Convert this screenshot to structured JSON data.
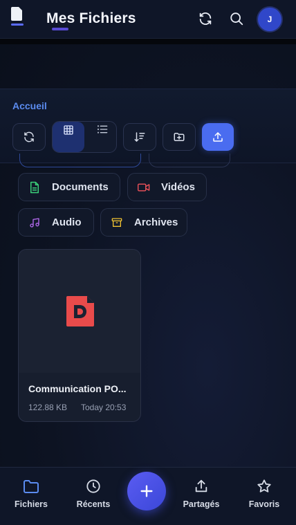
{
  "header": {
    "title": "Mes Fichiers",
    "avatar_initial": "J",
    "icons": [
      "app-logo-icon",
      "refresh-icon",
      "search-icon"
    ]
  },
  "breadcrumb": {
    "root": "Accueil"
  },
  "toolbar": {
    "icons": [
      "refresh-icon",
      "grid-view-icon",
      "list-view-icon",
      "sort-icon",
      "new-folder-icon",
      "upload-icon"
    ],
    "active_view": "grid",
    "accent": "#4a6cf0"
  },
  "filters": [
    {
      "label": "Documents",
      "icon": "document-icon",
      "color": "#3bd17a"
    },
    {
      "label": "Vidéos",
      "icon": "video-icon",
      "color": "#f0525a"
    },
    {
      "label": "Audio",
      "icon": "music-icon",
      "color": "#b46af0"
    },
    {
      "label": "Archives",
      "icon": "archive-icon",
      "color": "#f0c232"
    }
  ],
  "files": [
    {
      "name": "Communication PO...",
      "size": "122.88 KB",
      "date": "Today 20:53",
      "icon": "pdf-file-icon",
      "icon_color": "#e94b4b"
    }
  ],
  "bottom_nav": {
    "items": [
      {
        "label": "Fichiers",
        "icon": "folder-icon",
        "active": true
      },
      {
        "label": "Récents",
        "icon": "clock-icon",
        "active": false
      },
      {
        "label": "Partagés",
        "icon": "share-icon",
        "active": false
      },
      {
        "label": "Favoris",
        "icon": "star-icon",
        "active": false
      }
    ],
    "fab_icon": "plus-icon",
    "active_color": "#5b8cf0"
  }
}
